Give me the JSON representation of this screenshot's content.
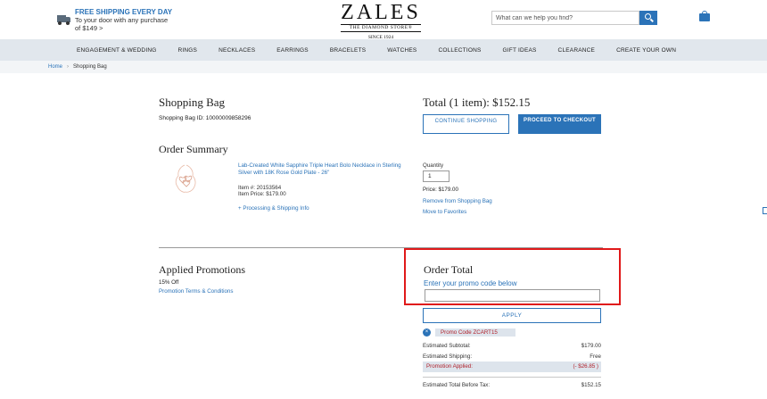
{
  "header": {
    "shipping_headline": "FREE SHIPPING EVERY DAY",
    "shipping_line2": "To your door with any purchase",
    "shipping_line3": "of $149 >",
    "logo_word": "ZALES",
    "logo_sub": "THE DIAMOND STORE®",
    "logo_since": "SINCE 1924",
    "search_placeholder": "What can we help you find?"
  },
  "nav": {
    "items": [
      "ENGAGEMENT & WEDDING",
      "RINGS",
      "NECKLACES",
      "EARRINGS",
      "BRACELETS",
      "WATCHES",
      "COLLECTIONS",
      "GIFT IDEAS",
      "CLEARANCE",
      "CREATE YOUR OWN"
    ]
  },
  "breadcrumb": {
    "home": "Home",
    "separator": "›",
    "current": "Shopping Bag"
  },
  "bag": {
    "title": "Shopping Bag",
    "bag_id": "Shopping Bag ID: 10000009858296",
    "summary_title": "Order Summary",
    "total_title": "Total (1 item): $152.15",
    "continue_label": "CONTINUE SHOPPING",
    "checkout_label": "PROCEED TO CHECKOUT"
  },
  "product": {
    "name": "Lab-Created White Sapphire Triple Heart Bolo Necklace in Sterling Silver with 18K Rose Gold Plate - 26\"",
    "item_number": "Item #: 20153564",
    "item_price": "Item Price: $179.00",
    "shipping_info": "+ Processing & Shipping Info",
    "quantity_label": "Quantity",
    "quantity_value": "1",
    "price": "Price: $179.00",
    "remove_label": "Remove from Shopping Bag",
    "favorites_label": "Move to Favorites"
  },
  "promotions": {
    "title": "Applied Promotions",
    "percent_off": "15% Off",
    "terms_label": "Promotion Terms & Conditions"
  },
  "order_total": {
    "title": "Order Total",
    "promo_prompt": "Enter your promo code below",
    "promo_value": "",
    "apply_label": "APPLY",
    "chip_close": "×",
    "promo_code_label": "Promo Code  ZCART15",
    "rows": [
      {
        "label": "Estimated Subtotal:",
        "value": "$179.00"
      },
      {
        "label": "Estimated Shipping:",
        "value": "Free"
      },
      {
        "label": "Promotion Applied:",
        "value": "(- $26.85 )"
      },
      {
        "label": "Estimated Total Before Tax:",
        "value": "$152.15"
      }
    ]
  },
  "colors": {
    "accent_blue": "#2b73b8",
    "nav_bg": "#e1e7ed",
    "highlight_red": "#e0191a",
    "promo_red": "#b0212b"
  }
}
